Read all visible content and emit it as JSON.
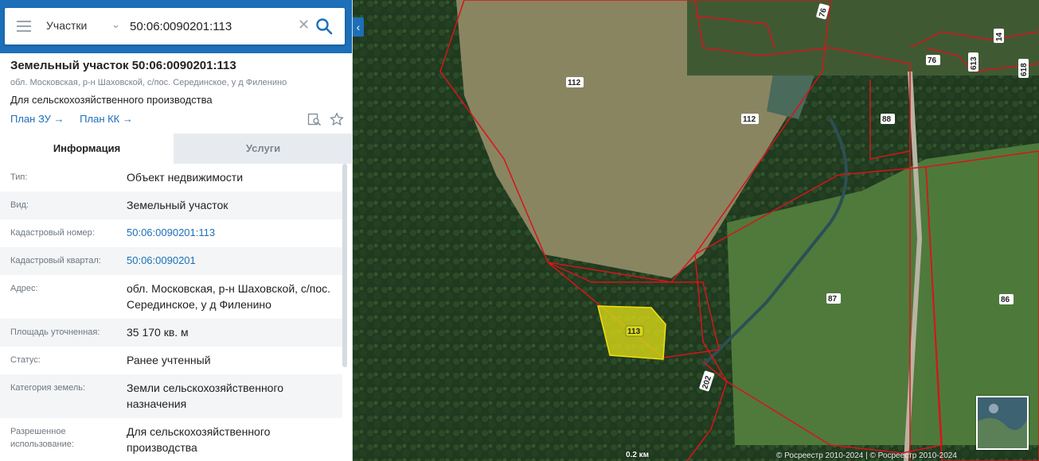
{
  "search": {
    "scope": "Участки",
    "query": "50:06:0090201:113"
  },
  "object": {
    "title": "Земельный участок 50:06:0090201:113",
    "address_short": "обл. Московская, р-н Шаховской, с/пос. Серединское, у д Филенино",
    "purpose": "Для сельскохозяйственного производства",
    "links": [
      "План ЗУ →",
      "План КК →"
    ]
  },
  "tabs": [
    "Информация",
    "Услуги"
  ],
  "info": [
    {
      "label": "Тип:",
      "value": "Объект недвижимости"
    },
    {
      "label": "Вид:",
      "value": "Земельный участок"
    },
    {
      "label": "Кадастровый номер:",
      "value": "50:06:0090201:113"
    },
    {
      "label": "Кадастровый квартал:",
      "value": "50:06:0090201"
    },
    {
      "label": "Адрес:",
      "value": "обл. Московская, р-н Шаховской, с/пос. Серединское, у д Филенино"
    },
    {
      "label": "Площадь уточненная:",
      "value": "35 170 кв. м"
    },
    {
      "label": "Статус:",
      "value": "Ранее учтенный"
    },
    {
      "label": "Категория земель:",
      "value": "Земли сельскохозяйственного назначения"
    },
    {
      "label": "Разрешенное использование:",
      "value": "Для сельскохозяйственного производства"
    }
  ],
  "map": {
    "selected_parcel": "113",
    "parcel_labels": [
      "112",
      "112",
      "88",
      "87",
      "86",
      "202",
      "76",
      "76",
      "613",
      "618",
      "14"
    ],
    "scale": "0.2 км",
    "copyright": "© Росреестр 2010-2024 | © Росреестр 2010-2024",
    "colors": {
      "boundary": "#d8141b",
      "selected_fill": "#d8d818",
      "accent": "#1c6fb8"
    }
  }
}
